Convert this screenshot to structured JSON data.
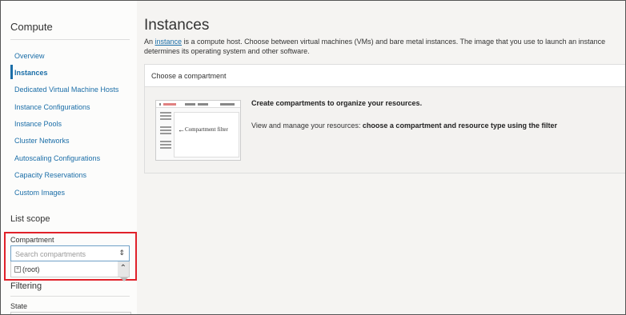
{
  "sidebar": {
    "title": "Compute",
    "items": [
      {
        "label": "Overview"
      },
      {
        "label": "Instances"
      },
      {
        "label": "Dedicated Virtual Machine Hosts"
      },
      {
        "label": "Instance Configurations"
      },
      {
        "label": "Instance Pools"
      },
      {
        "label": "Cluster Networks"
      },
      {
        "label": "Autoscaling Configurations"
      },
      {
        "label": "Capacity Reservations"
      },
      {
        "label": "Custom Images"
      }
    ],
    "active_item": "Instances",
    "list_scope": {
      "heading": "List scope",
      "compartment_label": "Compartment",
      "search_placeholder": "Search compartments",
      "tree_root": "(root)"
    },
    "filtering": {
      "heading": "Filtering",
      "state_label": "State"
    }
  },
  "main": {
    "title": "Instances",
    "description": {
      "prefix": "An ",
      "link": "instance",
      "suffix": " is a compute host. Choose between virtual machines (VMs) and bare metal instances. The image that you use to launch an instance determines its operating system and other software."
    },
    "panel": {
      "header": "Choose a compartment",
      "illustration_caption": "Compartment filter",
      "headline": "Create compartments to organize your resources.",
      "text_prefix": "View and manage your resources: ",
      "text_bold": "choose a compartment and resource type using the filter"
    }
  },
  "colors": {
    "link": "#1b6ea8",
    "highlight": "#e0212a"
  }
}
